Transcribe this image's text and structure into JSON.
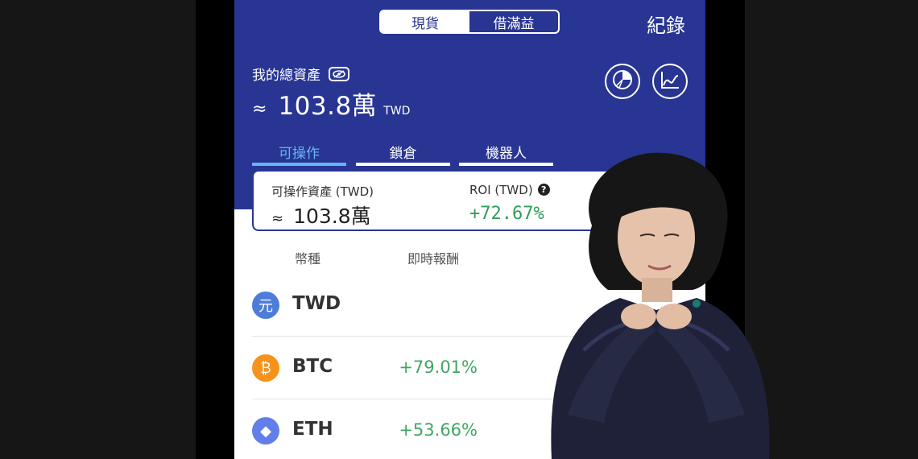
{
  "header": {
    "segments": [
      "現貨",
      "借滿益"
    ],
    "active_segment": 0,
    "record_label": "紀錄",
    "total_label": "我的總資產",
    "total_approx": "≈",
    "total_value": "103.8萬",
    "total_unit": "TWD",
    "tabs": [
      "可操作",
      "鎖倉",
      "機器人"
    ],
    "active_tab": 0
  },
  "card": {
    "assets_label": "可操作資產 (TWD)",
    "assets_approx": "≈",
    "assets_value": "103.8萬",
    "roi_label": "ROI (TWD)",
    "roi_value": "+72.67%",
    "help_glyph": "?"
  },
  "columns": {
    "coin": "幣種",
    "roi": "即時報酬"
  },
  "rows": [
    {
      "icon": "twd-coin-icon",
      "glyph": "元",
      "symbol": "TWD",
      "roi": "",
      "color": "#4e7cd9"
    },
    {
      "icon": "btc-coin-icon",
      "glyph": "₿",
      "symbol": "BTC",
      "roi": "+79.01%",
      "color": "#f7931a"
    },
    {
      "icon": "eth-coin-icon",
      "glyph": "◆",
      "symbol": "ETH",
      "roi": "+53.66%",
      "color": "#627eea"
    }
  ],
  "colors": {
    "header_bg": "#283593",
    "active_tab": "#64b5f6",
    "positive": "#3fa763"
  }
}
